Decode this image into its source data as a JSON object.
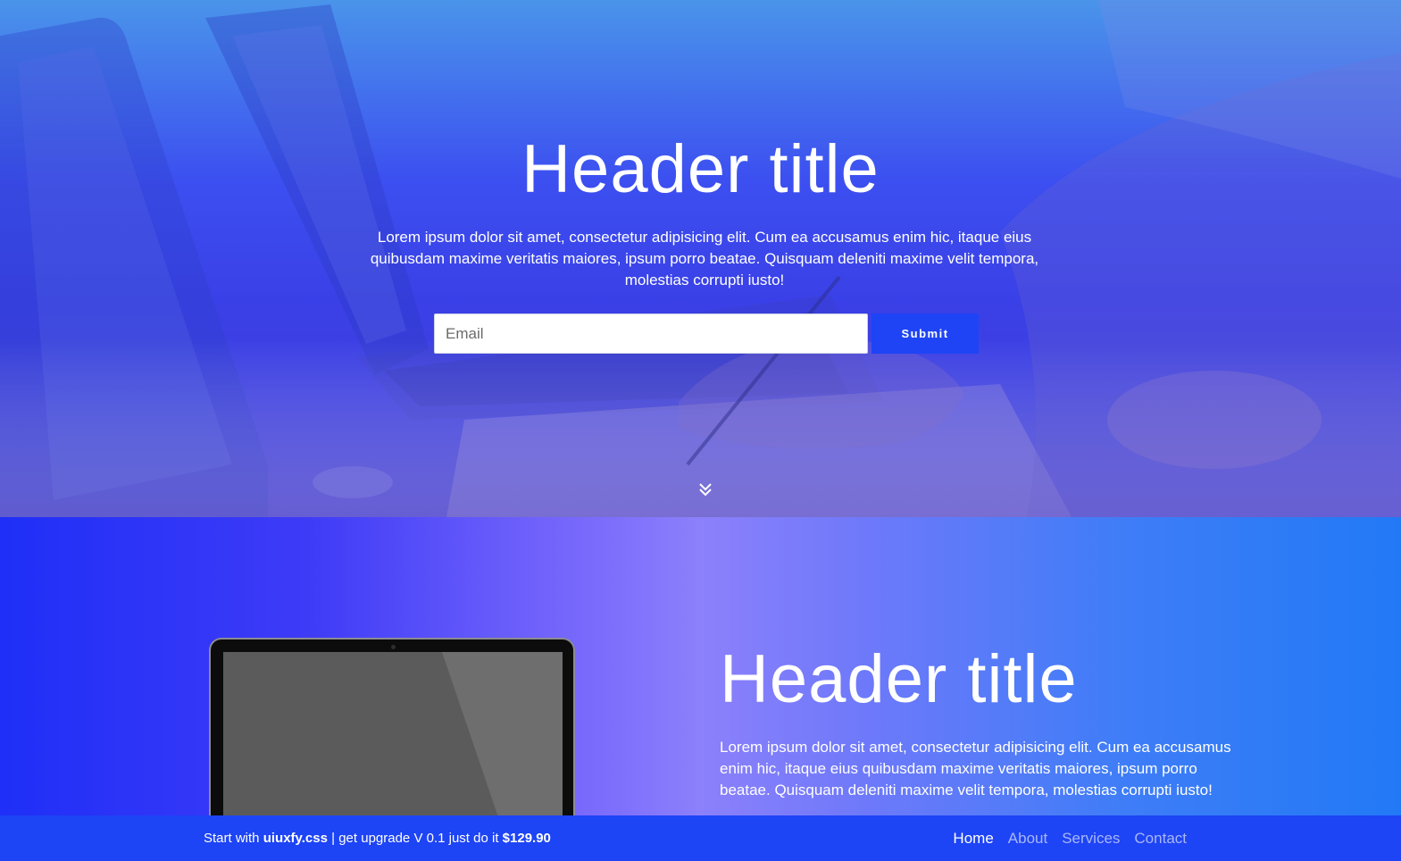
{
  "hero": {
    "title": "Header title",
    "text": "Lorem ipsum dolor sit amet, consectetur adipisicing elit. Cum ea accusamus enim hic, itaque eius quibusdam maxime veritatis maiores, ipsum porro beatae. Quisquam deleniti maxime velit tempora, molestias corrupti iusto!",
    "email_placeholder": "Email",
    "submit_label": "Submit",
    "scroll_icon": "double-chevron-down-icon"
  },
  "feature": {
    "title": "Header title",
    "text": "Lorem ipsum dolor sit amet, consectetur adipisicing elit. Cum ea accusamus enim hic, itaque eius quibusdam maxime veritatis maiores, ipsum porro beatae. Quisquam deleniti maxime velit tempora, molestias corrupti iusto!"
  },
  "bottom_bar": {
    "promo_prefix": "Start with",
    "promo_brand": "uiuxfy.css",
    "promo_middle": "| get upgrade V 0.1 just do it",
    "promo_price": "$129.90",
    "nav": [
      {
        "label": "Home",
        "active": true
      },
      {
        "label": "About",
        "active": false
      },
      {
        "label": "Services",
        "active": false
      },
      {
        "label": "Contact",
        "active": false
      }
    ]
  },
  "colors": {
    "accent": "#1e44f5",
    "bar": "#1d44f5",
    "nav_inactive": "#a9b7f9"
  }
}
